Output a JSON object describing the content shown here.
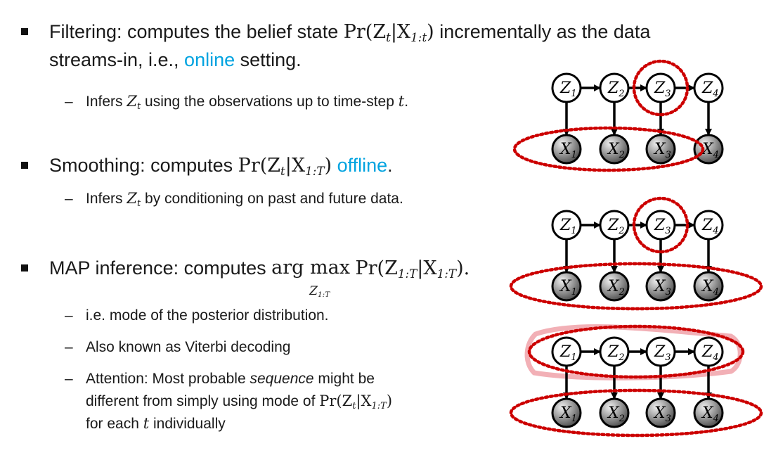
{
  "slide": {
    "filtering": {
      "label": "Filtering: computes the belief state ",
      "formula": "Pr(Z",
      "formula_sub": "t",
      "formula_mid": "|X",
      "formula_sub2": "1:t",
      "formula_end": ")",
      "rest": " incrementally as the data",
      "line2_pre": "streams-in, i.e., ",
      "line2_highlight": "online",
      "line2_post": " setting.",
      "sub1_pre": "Infers ",
      "sub1_var": "Z",
      "sub1_var_sub": "t",
      "sub1_post": " using the observations up to time-step ",
      "sub1_t": "t",
      "sub1_end": "."
    },
    "smoothing": {
      "label": "Smoothing: computes ",
      "formula": "Pr(Z",
      "formula_sub": "t",
      "formula_mid": "|X",
      "formula_sub2": "1:T",
      "formula_end": ")",
      "highlight": "offline",
      "period": ".",
      "sub1_pre": "Infers ",
      "sub1_var": "Z",
      "sub1_var_sub": "t",
      "sub1_post": " by conditioning on past and future data."
    },
    "map": {
      "label": "MAP inference: computes ",
      "argmax": "arg max",
      "argmax_under": "Z",
      "argmax_under_sub": "1:T",
      "formula": "Pr(Z",
      "formula_sub": "1:T",
      "formula_mid": "|X",
      "formula_sub2": "1:T",
      "formula_end": ").",
      "sub1": "i.e. mode of the posterior distribution.",
      "sub2": "Also known as Viterbi decoding",
      "sub3_pre": "Attention: Most probable ",
      "sub3_em": "sequence",
      "sub3_post": " might  be",
      "sub3_line2_pre": "different from simply using mode of ",
      "sub3_formula": "Pr(Z",
      "sub3_formula_sub": "t",
      "sub3_formula_mid": "|X",
      "sub3_formula_sub2": "1:T",
      "sub3_formula_end": ")",
      "sub3_line3_pre": "for each ",
      "sub3_line3_t": "t",
      "sub3_line3_post": " individually"
    },
    "dash": "–"
  },
  "diagrams": [
    {
      "hidden": [
        "Z1",
        "Z2",
        "Z3",
        "Z4"
      ],
      "observed": [
        "X1",
        "X2",
        "X3",
        "X4"
      ],
      "highlight": "filtering"
    },
    {
      "hidden": [
        "Z1",
        "Z2",
        "Z3",
        "Z4"
      ],
      "observed": [
        "X1",
        "X2",
        "X3",
        "X4"
      ],
      "highlight": "smoothing"
    },
    {
      "hidden": [
        "Z1",
        "Z2",
        "Z3",
        "Z4"
      ],
      "observed": [
        "X1",
        "X2",
        "X3",
        "X4"
      ],
      "highlight": "map"
    }
  ],
  "colors": {
    "text": "#1a1a1a",
    "accent_blue": "#00a3e0",
    "dotted_red": "#cc0000",
    "highlighter_pink": "#e8707a",
    "observed_fill_dark": "#555555",
    "observed_fill_light": "#e8e8e8"
  }
}
